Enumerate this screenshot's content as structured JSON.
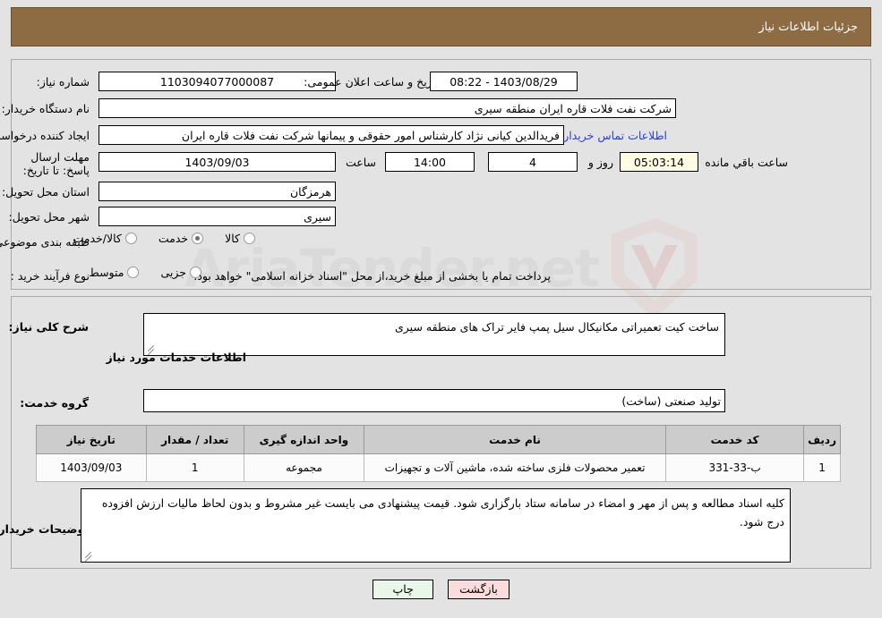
{
  "header": {
    "title": "جزئیات اطلاعات نیاز"
  },
  "summary": {
    "need_number_label": "شماره نیاز:",
    "need_number_value": "1103094077000087",
    "announce_label": "تاریخ و ساعت اعلان عمومی:",
    "announce_value": "08:22 - 1403/08/29",
    "buyer_org_label": "نام دستگاه خریدار:",
    "buyer_org_value": "شرکت نفت فلات قاره ایران منطقه سیری",
    "requester_label": "ایجاد کننده درخواست:",
    "requester_value": "فریدالدین کیانی نژاد کارشناس امور حقوقی و پیمانها شرکت نفت فلات قاره ایران",
    "contact_link": "اطلاعات تماس خریدار",
    "deadline_label": "مهلت ارسال پاسخ: تا تاریخ:",
    "deadline_date": "1403/09/03",
    "hour_label": "ساعت",
    "deadline_time": "14:00",
    "days_value": "4",
    "days_label": "روز و",
    "countdown_value": "05:03:14",
    "remaining_label": "ساعت باقي مانده",
    "province_label": "استان محل تحویل:",
    "province_value": "هرمزگان",
    "city_label": "شهر محل تحویل:",
    "city_value": "سیری",
    "classification_label": "طبقه بندی موضوعی:",
    "classification_options": [
      {
        "label": "کالا",
        "checked": false
      },
      {
        "label": "خدمت",
        "checked": true
      },
      {
        "label": "کالا/خدمت",
        "checked": false
      }
    ],
    "process_label": "نوع فرآیند خرید :",
    "process_options": [
      {
        "label": "جزیی",
        "checked": false
      },
      {
        "label": "متوسط",
        "checked": false
      }
    ],
    "process_note": "پرداخت تمام یا بخشی از مبلغ خرید،از محل \"اسناد خزانه اسلامی\" خواهد بود."
  },
  "details": {
    "general_desc_label": "شرح کلی نیاز:",
    "general_desc_value": "ساخت کیت تعمیراتی مکانیکال سیل پمپ فایر تراک های منطقه سیری",
    "services_section_title": "اطلاعات خدمات مورد نیاز",
    "service_group_label": "گروه خدمت:",
    "service_group_value": "تولید صنعتی (ساخت)",
    "table": {
      "columns": [
        "ردیف",
        "کد خدمت",
        "نام خدمت",
        "واحد اندازه گیری",
        "تعداد / مقدار",
        "تاریخ نیاز"
      ],
      "rows": [
        {
          "row_no": "1",
          "service_code": "ب-33-331",
          "service_name": "تعمیر محصولات فلزی ساخته شده، ماشین آلات و تجهیزات",
          "unit": "مجموعه",
          "quantity": "1",
          "need_date": "1403/09/03"
        }
      ]
    },
    "buyer_notes_label": "توضیحات خریدار:",
    "buyer_notes_value": "کلیه اسناد مطالعه و پس از مهر و امضاء در سامانه ستاد بارگزاری شود. قیمت پیشنهادی می بایست غیر مشروط و بدون لحاظ مالیات ارزش افزوده درج شود."
  },
  "footer": {
    "print_label": "چاپ",
    "back_label": "بازگشت"
  },
  "watermark": {
    "text": "AriaTender.net"
  },
  "colors": {
    "header_bg": "#8d6b43",
    "page_bg": "#e3e3e3",
    "link": "#2a3fd8",
    "countdown_bg": "#fffce4",
    "table_header_bg": "#cccccc",
    "print_btn_bg": "#e9f7e9",
    "back_btn_bg": "#fbdcdc"
  }
}
